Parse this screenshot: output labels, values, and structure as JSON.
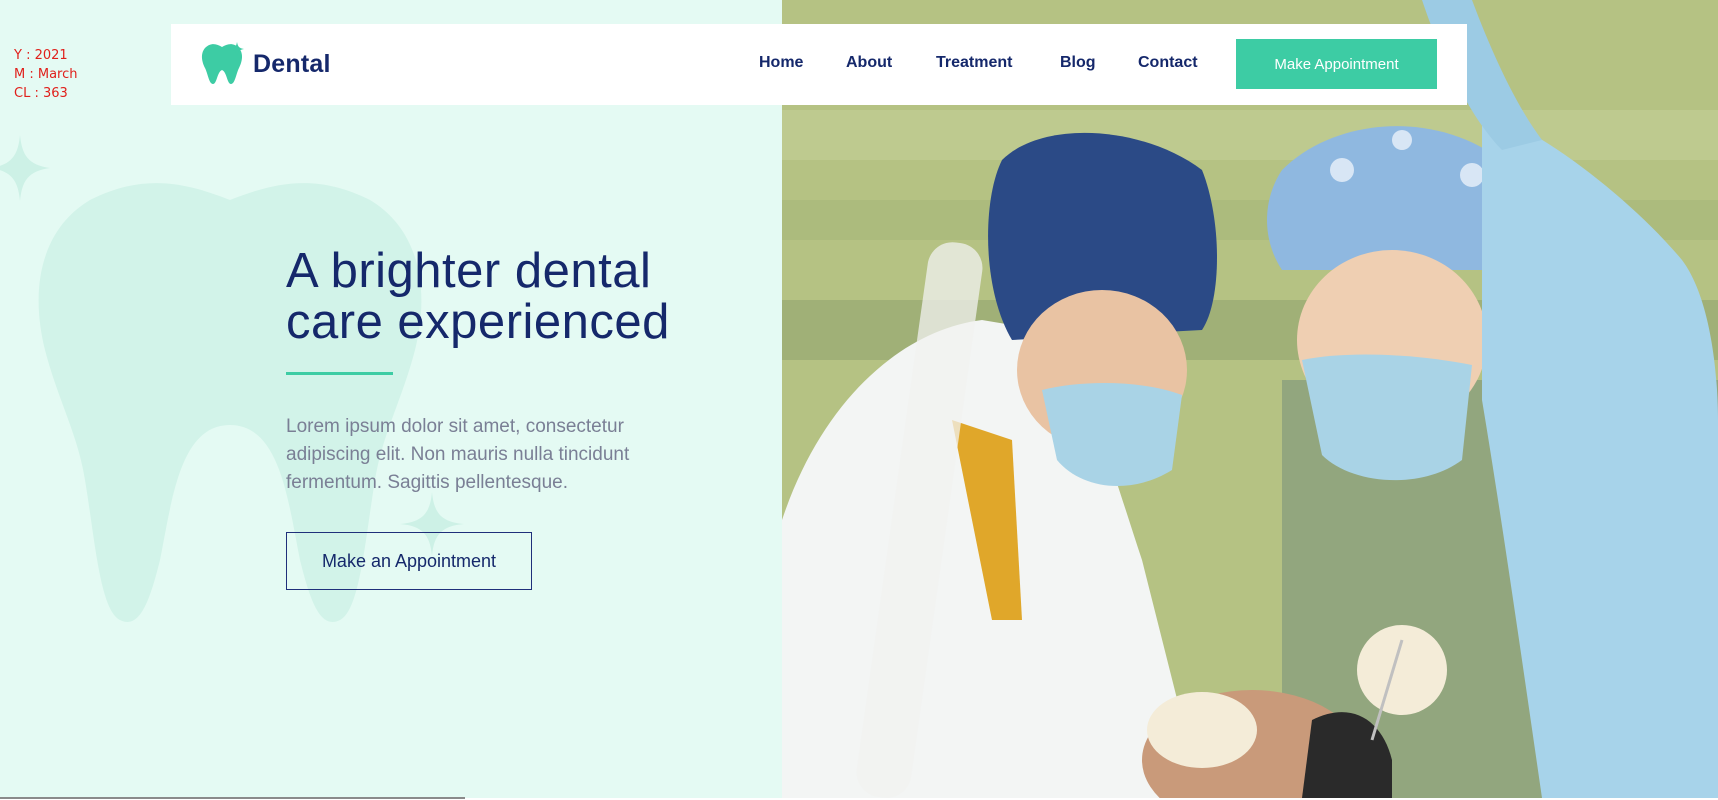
{
  "meta": {
    "year": "Y : 2021",
    "month": "M : March",
    "cl": "CL : 363"
  },
  "brand": {
    "name": "Dental",
    "accent": "#3dcca4",
    "navy": "#15286b",
    "light_bg": "#e4faf3"
  },
  "nav": {
    "items": [
      "Home",
      "About",
      "Treatment",
      "Blog",
      "Contact"
    ],
    "cta_label": "Make Appointment"
  },
  "hero": {
    "title_line1": "A brighter dental",
    "title_line2": "care experienced",
    "desc_line1": "Lorem ipsum dolor sit amet, consectetur",
    "desc_line2": "adipiscing elit. Non mauris nulla tincidunt",
    "desc_line3": "fermentum. Sagittis pellentesque.",
    "button_label": "Make an Appointment"
  },
  "photo": {
    "icon": "dentists-treating-patient-photo"
  }
}
